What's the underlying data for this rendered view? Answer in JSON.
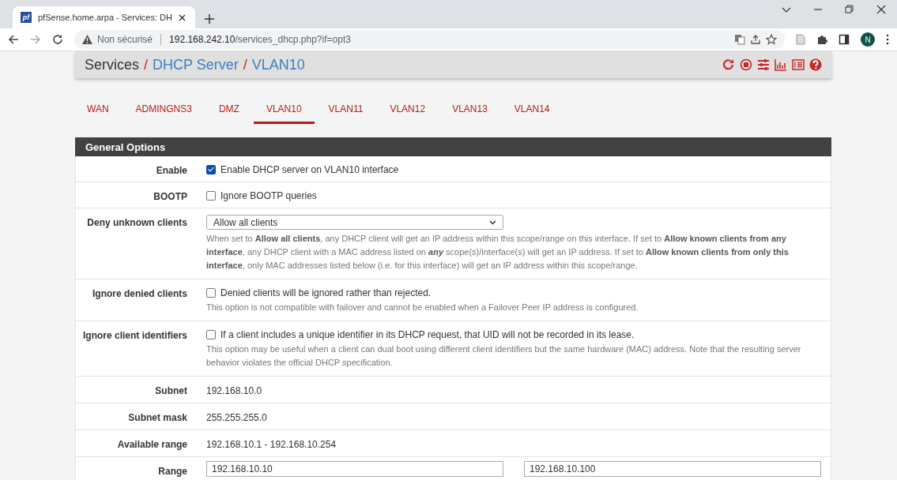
{
  "browser": {
    "tab_icon": "pf",
    "tab_title": "pfSense.home.arpa - Services: DH",
    "security": "Non sécurisé",
    "host": "192.168.242.10",
    "path": "/services_dhcp.php?if=opt3",
    "avatar": "N"
  },
  "breadcrumb": {
    "separator": "/",
    "items": [
      {
        "text": "Services",
        "link": false
      },
      {
        "text": "DHCP Server",
        "link": true
      },
      {
        "text": "VLAN10",
        "link": true
      }
    ]
  },
  "tabs": [
    {
      "label": "WAN",
      "selected": false
    },
    {
      "label": "ADMINGNS3",
      "selected": false
    },
    {
      "label": "DMZ",
      "selected": false
    },
    {
      "label": "VLAN10",
      "selected": true
    },
    {
      "label": "VLAN11",
      "selected": false
    },
    {
      "label": "VLAN12",
      "selected": false
    },
    {
      "label": "VLAN13",
      "selected": false
    },
    {
      "label": "VLAN14",
      "selected": false
    }
  ],
  "panel": {
    "title": "General Options",
    "rows": [
      {
        "kind": "checkbox",
        "label": "Enable",
        "checked": true,
        "text": "Enable DHCP server on VLAN10 interface"
      },
      {
        "kind": "checkbox",
        "label": "BOOTP",
        "checked": false,
        "text": "Ignore BOOTP queries"
      },
      {
        "kind": "select",
        "label": "Deny unknown clients",
        "value": "Allow all clients",
        "help": "When set to **Allow all clients**, any DHCP client will get an IP address within this scope/range on this interface. If set to **Allow known clients from any interface**, any DHCP client with a MAC address listed on *any* scope(s)/interface(s) will get an IP address. If set to **Allow known clients from only this interface**, only MAC addresses listed below (i.e. for this interface) will get an IP address within this scope/range."
      },
      {
        "kind": "checkbox",
        "label": "Ignore denied clients",
        "checked": false,
        "text": "Denied clients will be ignored rather than rejected.",
        "help": "This option is not compatible with failover and cannot be enabled when a Failover Peer IP address is configured."
      },
      {
        "kind": "checkbox",
        "label": "Ignore client identifiers",
        "checked": false,
        "text": "If a client includes a unique identifier in its DHCP request, that UID will not be recorded in its lease.",
        "help": "This option may be useful when a client can dual boot using different client identifiers but the same hardware (MAC) address. Note that the resulting server behavior violates the official DHCP specification."
      },
      {
        "kind": "value",
        "label": "Subnet",
        "value": "192.168.10.0"
      },
      {
        "kind": "value",
        "label": "Subnet mask",
        "value": "255.255.255.0"
      },
      {
        "kind": "value",
        "label": "Available range",
        "value": "192.168.10.1 - 192.168.10.254"
      },
      {
        "kind": "range",
        "label": "Range",
        "from": "192.168.10.10",
        "to": "192.168.10.100"
      }
    ]
  }
}
